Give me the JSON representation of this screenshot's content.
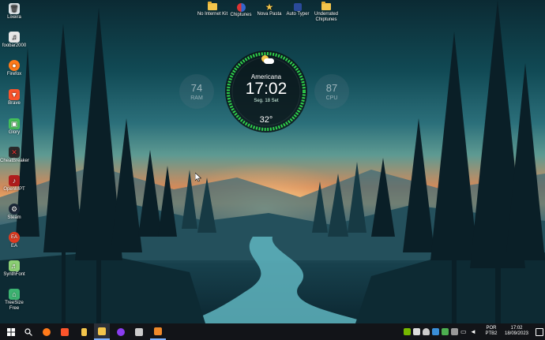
{
  "desktop_icons_left": [
    {
      "label": "Lixeira",
      "icon": "recycle-bin-icon",
      "color": "#dfe6ea"
    },
    {
      "label": "foobar2000",
      "icon": "foobar-icon",
      "color": "#e8e8e8"
    },
    {
      "label": "Firefox",
      "icon": "firefox-icon",
      "color": "#ff7a1a"
    },
    {
      "label": "Brave",
      "icon": "brave-icon",
      "color": "#fb542b"
    },
    {
      "label": "Glory",
      "icon": "glory-icon",
      "color": "#44c05a"
    },
    {
      "label": "CheatBreaker",
      "icon": "cheatbreaker-icon",
      "color": "#2a2a2a"
    },
    {
      "label": "OpenMPT",
      "icon": "openmpt-icon",
      "color": "#b01c1c"
    },
    {
      "label": "Steam",
      "icon": "steam-icon",
      "color": "#1b2838"
    },
    {
      "label": "EA",
      "icon": "ea-icon",
      "color": "#e03b20"
    },
    {
      "label": "SynthFont",
      "icon": "synthfont-icon",
      "color": "#8ccf74"
    },
    {
      "label": "TreeSize Free",
      "icon": "treesize-icon",
      "color": "#3cb371"
    }
  ],
  "desktop_icons_top": [
    {
      "label": "No Internet Kit",
      "icon": "folder-icon"
    },
    {
      "label": "Chiptunes",
      "icon": "chiptunes-icon"
    },
    {
      "label": "Nova Pasta",
      "icon": "star-icon"
    },
    {
      "label": "Auto Typer",
      "icon": "auto-typer-icon"
    },
    {
      "label": "Underrated Chiptunes",
      "icon": "folder-icon"
    }
  ],
  "clock_widget": {
    "city": "Americana",
    "time": "17:02",
    "date": "Seg. 18 Set",
    "temperature": "32°",
    "weather_icon": "partly-cloudy-icon"
  },
  "gauges": {
    "ram": {
      "value": "74",
      "label": "RAM"
    },
    "cpu": {
      "value": "87",
      "label": "CPU"
    }
  },
  "taskbar": {
    "apps": [
      {
        "name": "windows-start-icon",
        "color": "#ffffff"
      },
      {
        "name": "search-icon",
        "color": "#ffffff"
      },
      {
        "name": "firefox-icon",
        "color": "#ff7a1a"
      },
      {
        "name": "brave-icon",
        "color": "#fb542b"
      },
      {
        "name": "file-explorer-icon",
        "color": "#f3c54b"
      },
      {
        "name": "explorer-folder-icon",
        "color": "#f3c54b"
      },
      {
        "name": "media-player-icon",
        "color": "#8a3df0"
      },
      {
        "name": "tweak-app-icon",
        "color": "#cccccc"
      },
      {
        "name": "trace-app-icon",
        "color": "#f08a2a"
      }
    ],
    "language": "POR",
    "keyboard": "PTB2",
    "time": "17:02",
    "date": "18/09/2023"
  },
  "tray_icons": [
    "nvidia-icon",
    "network-icon",
    "shield-icon",
    "volume-icon",
    "security-icon",
    "cloud-icon",
    "usb-icon",
    "notification-icon"
  ]
}
